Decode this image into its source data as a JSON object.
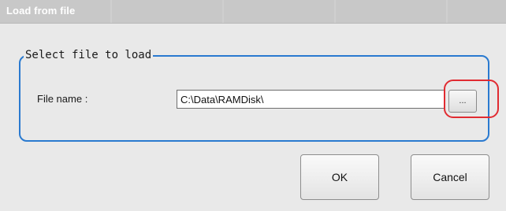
{
  "window": {
    "title": "Load from file"
  },
  "group": {
    "title": "Select file to load",
    "file_name_label": "File name :",
    "file_path_value": "C:\\Data\\RAMDisk\\",
    "browse_label": "..."
  },
  "buttons": {
    "ok_label": "OK",
    "cancel_label": "Cancel"
  },
  "colors": {
    "group_border": "#2a7ad0",
    "highlight_ring": "#e12b31",
    "dialog_background": "#e9e9e9",
    "title_bar": "#c9c9c9"
  }
}
